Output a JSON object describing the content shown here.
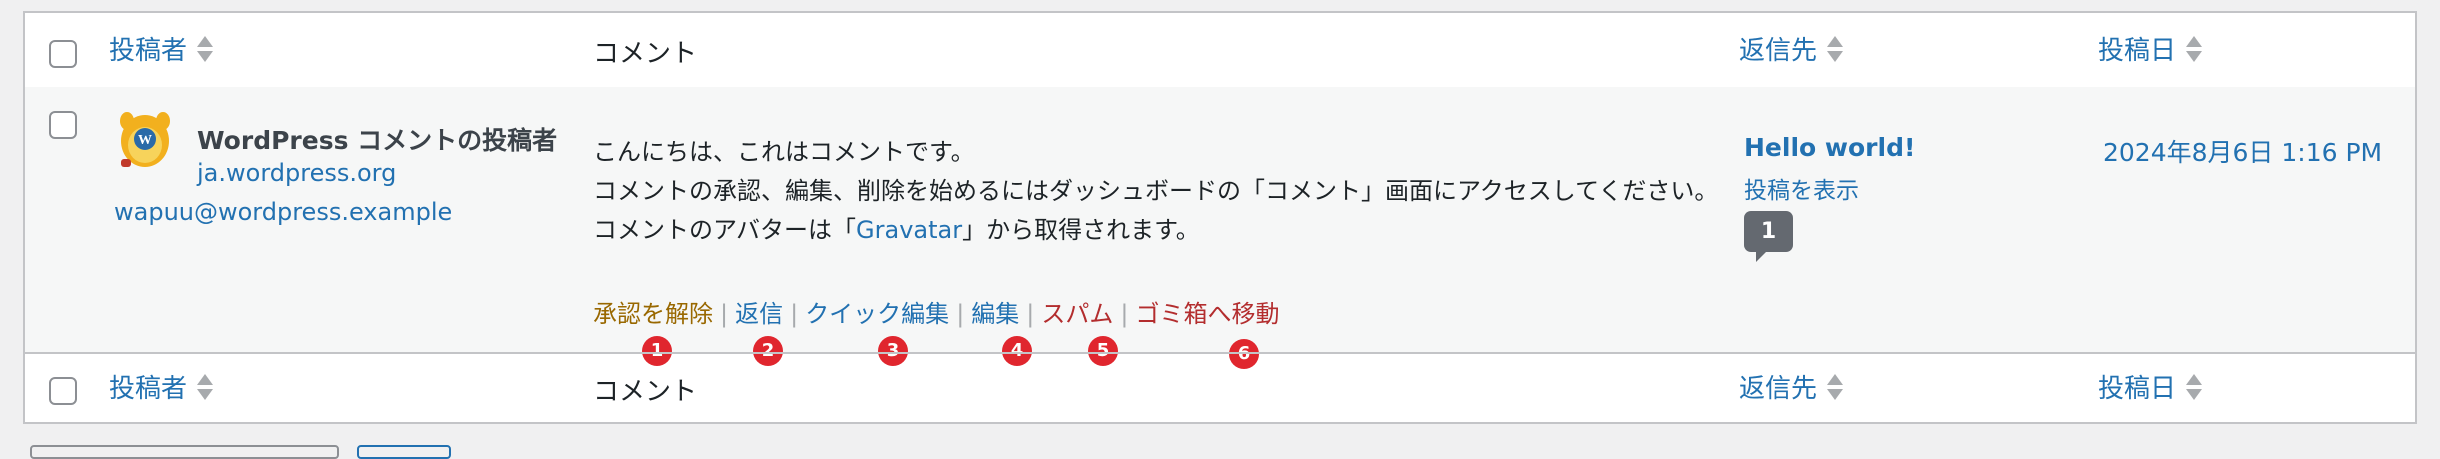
{
  "columns": {
    "author": "投稿者",
    "comment": "コメント",
    "response": "返信先",
    "date": "投稿日"
  },
  "comment": {
    "author_name": "WordPress コメントの投稿者",
    "author_url": "ja.wordpress.org",
    "author_email": "wapuu@wordpress.example",
    "avatar_icon": "wapuu-avatar-icon",
    "line1": "こんにちは、これはコメントです。",
    "line2": "コメントの承認、編集、削除を始めるにはダッシュボードの「コメント」画面にアクセスしてください。",
    "line3_prefix": "コメントのアバターは「",
    "line3_link": "Gravatar",
    "line3_suffix": "」から取得されます。"
  },
  "row_actions": {
    "unapprove": "承認を解除",
    "reply": "返信",
    "quick_edit": "クイック編集",
    "edit": "編集",
    "spam": "スパム",
    "trash": "ゴミ箱へ移動",
    "separator": "|"
  },
  "badges": [
    "1",
    "2",
    "3",
    "4",
    "5",
    "6"
  ],
  "response": {
    "post_title": "Hello world!",
    "view_post": "投稿を表示",
    "comment_count": "1"
  },
  "date": "2024年8月6日 1:16 PM",
  "colors": {
    "link": "#2271b1",
    "unapprove": "#996800",
    "danger": "#b32d2e",
    "badge": "#e0262e"
  }
}
